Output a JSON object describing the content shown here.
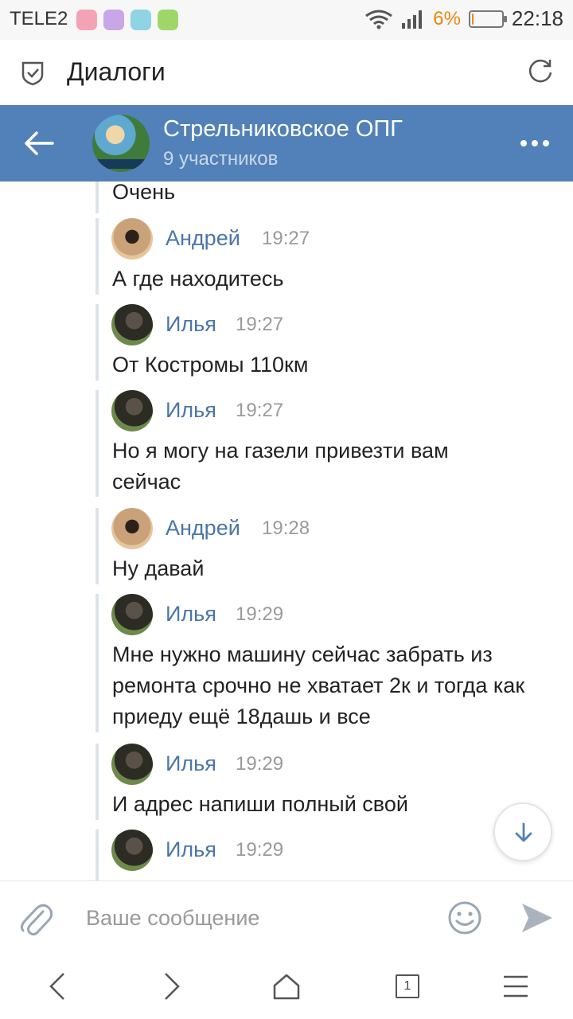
{
  "status_bar": {
    "carrier": "TELE2",
    "battery_percent": "6%",
    "battery_level": 0.06,
    "time": "22:18",
    "app_icon_colors": [
      "#f3a3b3",
      "#c9a6e8",
      "#8fd4e2",
      "#9ed66a"
    ]
  },
  "topbar": {
    "title": "Диалоги"
  },
  "chat": {
    "title": "Стрельниковское ОПГ",
    "subtitle": "9 участников"
  },
  "messages": [
    {
      "type": "continuation",
      "text": "Очень"
    },
    {
      "type": "full",
      "author": "Андрей",
      "time": "19:27",
      "text": "А где находитесь"
    },
    {
      "type": "full",
      "author": "Илья",
      "time": "19:27",
      "text": "От Костромы 110км"
    },
    {
      "type": "full",
      "author": "Илья",
      "time": "19:27",
      "text": "Но я могу на газели привезти вам сейчас"
    },
    {
      "type": "full",
      "author": "Андрей",
      "time": "19:28",
      "text": "Ну давай"
    },
    {
      "type": "full",
      "author": "Илья",
      "time": "19:29",
      "text": "Мне нужно машину сейчас забрать из ремонта срочно не хватает 2к и тогда как приеду ещё 18дашь и все"
    },
    {
      "type": "full",
      "author": "Илья",
      "time": "19:29",
      "text": "И адрес напиши полный свой"
    },
    {
      "type": "full",
      "author": "Илья",
      "time": "19:29",
      "text": ""
    }
  ],
  "composer": {
    "placeholder": "Ваше сообщение"
  },
  "navbar": {
    "tab_count": "1"
  },
  "colors": {
    "accent": "#5181b8",
    "name": "#4a76a8",
    "battery": "#e8880f"
  },
  "icons": [
    "shield-icon",
    "refresh-icon",
    "back-arrow-icon",
    "more-icon",
    "scroll-down-icon",
    "attach-icon",
    "emoji-icon",
    "send-icon",
    "nav-back-icon",
    "nav-forward-icon",
    "nav-home-icon",
    "nav-tabs-icon",
    "nav-menu-icon"
  ]
}
